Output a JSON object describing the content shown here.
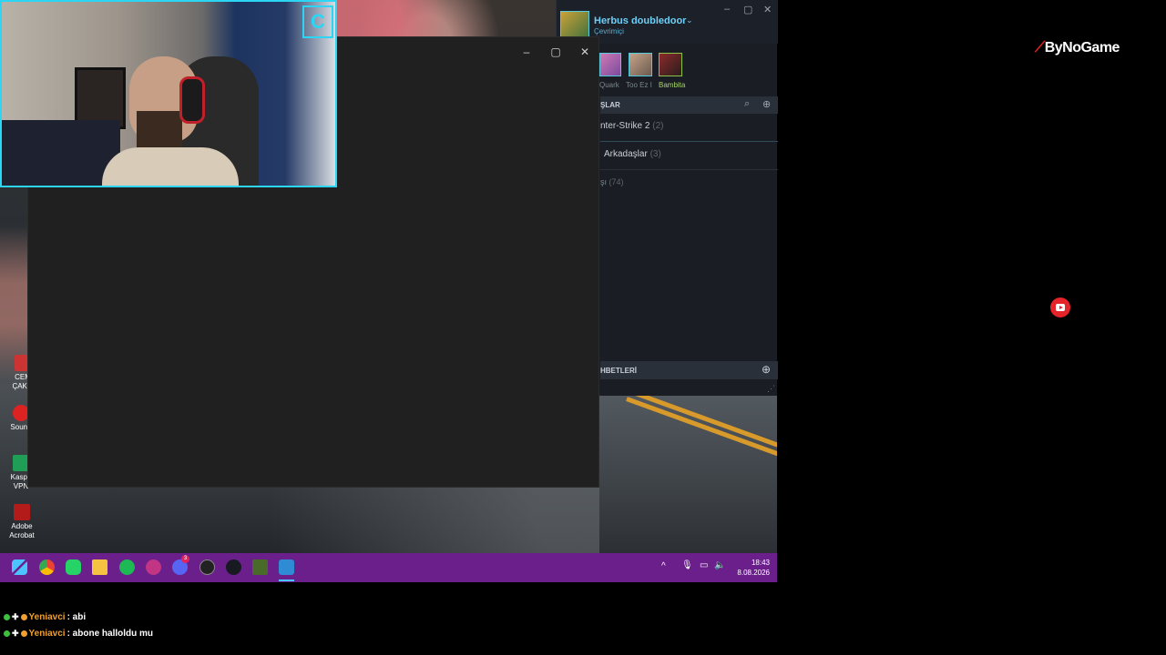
{
  "steam": {
    "username": "Herbus doubledoor",
    "status": "Çevrimiçi",
    "recent": [
      "Quark",
      "Too Ez I",
      "Bambita"
    ],
    "friends_header": "ŞLAR",
    "groups": [
      {
        "name": "nter-Strike 2",
        "count": "(2)"
      },
      {
        "name": "Arkadaşlar",
        "count": "(3)"
      },
      {
        "name": "şı",
        "count": "(74)"
      }
    ],
    "chats_header": "HBETLERİ"
  },
  "desktop_icons": [
    {
      "label": "CEM ÇAKM"
    },
    {
      "label": "Sound"
    },
    {
      "label": "Kaspe VPN"
    },
    {
      "label": "Adobe Acrobat"
    }
  ],
  "taskbar": {
    "time": "18:43",
    "date": "8.08.2026",
    "discord_badge": "3"
  },
  "overlay": {
    "brand": "ByNoGame"
  },
  "chat": [
    {
      "user": "Yeniavci",
      "message": ": abi"
    },
    {
      "user": "Yeniavci",
      "message": ": abone halloldu mu"
    }
  ],
  "colors": {
    "taskbar": "#6a1f8a",
    "webcam_border": "#2bd6f5",
    "steam_name": "#6dcff6",
    "chat_user": "#f0a030"
  }
}
